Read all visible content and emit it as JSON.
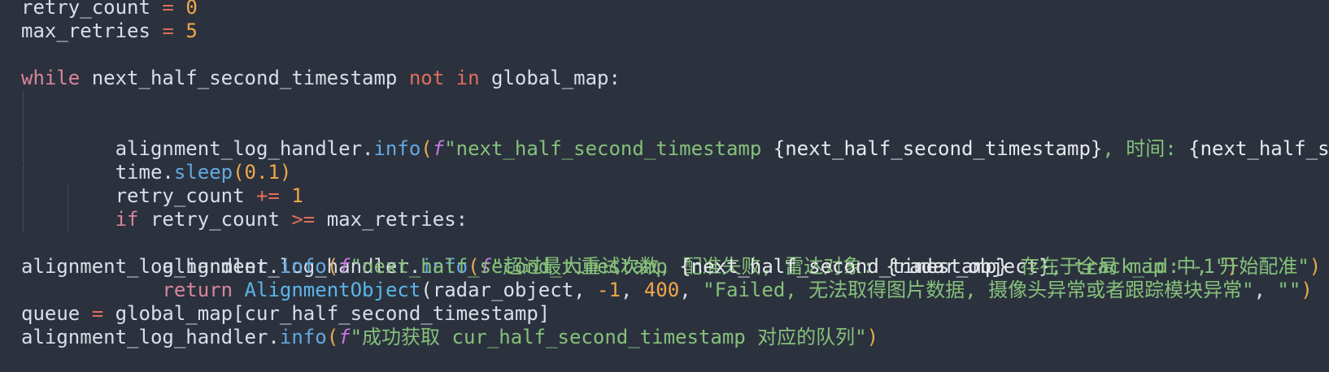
{
  "editor": {
    "lines": [
      [
        {
          "t": "retry_count",
          "c": "var"
        },
        {
          "t": " ",
          "c": "var"
        },
        {
          "t": "=",
          "c": "op"
        },
        {
          "t": " ",
          "c": "var"
        },
        {
          "t": "0",
          "c": "num"
        }
      ],
      [
        {
          "t": "max_retries",
          "c": "var"
        },
        {
          "t": " ",
          "c": "var"
        },
        {
          "t": "=",
          "c": "op"
        },
        {
          "t": " ",
          "c": "var"
        },
        {
          "t": "5",
          "c": "num"
        }
      ],
      [],
      [
        {
          "t": "while",
          "c": "kw"
        },
        {
          "t": " next_half_second_timestamp ",
          "c": "var"
        },
        {
          "t": "not",
          "c": "op"
        },
        {
          "t": " ",
          "c": "var"
        },
        {
          "t": "in",
          "c": "op"
        },
        {
          "t": " global_map:",
          "c": "var"
        }
      ],
      [
        {
          "t": "    ",
          "c": "var"
        },
        {
          "t": "alignment_log_handler.",
          "c": "var"
        },
        {
          "t": "info",
          "c": "fn"
        },
        {
          "t": "(",
          "c": "paren"
        },
        {
          "t": "f",
          "c": "fpre"
        },
        {
          "t": "\"next_half_second_timestamp ",
          "c": "str"
        },
        {
          "t": "{next_half_second_timestamp}",
          "c": "brace"
        },
        {
          "t": ", 时间: ",
          "c": "str"
        },
        {
          "t": "{next_half_second_timestamp_str}\")",
          "c": "brace"
        }
      ],
      [
        {
          "t": "    ",
          "c": "var"
        },
        {
          "t": "time.",
          "c": "var"
        },
        {
          "t": "sleep",
          "c": "fn"
        },
        {
          "t": "(",
          "c": "paren"
        },
        {
          "t": "0.1",
          "c": "num"
        },
        {
          "t": ")",
          "c": "paren"
        }
      ],
      [
        {
          "t": "    ",
          "c": "var"
        },
        {
          "t": "retry_count ",
          "c": "var"
        },
        {
          "t": "+=",
          "c": "op"
        },
        {
          "t": " ",
          "c": "var"
        },
        {
          "t": "1",
          "c": "num"
        }
      ],
      [
        {
          "t": "    ",
          "c": "var"
        },
        {
          "t": "if",
          "c": "kw"
        },
        {
          "t": " retry_count ",
          "c": "var"
        },
        {
          "t": ">=",
          "c": "op"
        },
        {
          "t": " max_retries:",
          "c": "var"
        }
      ],
      [
        {
          "t": "        ",
          "c": "var"
        },
        {
          "t": "alignment_log_handler.",
          "c": "var"
        },
        {
          "t": "info",
          "c": "fn"
        },
        {
          "t": "(",
          "c": "paren"
        },
        {
          "t": "f",
          "c": "fpre"
        },
        {
          "t": "\"超过最大重试次数, 配准失败, 雷达对象: ",
          "c": "str"
        },
        {
          "t": "{radar_object}",
          "c": "brace"
        },
        {
          "t": ", track_id: -1\"",
          "c": "str"
        },
        {
          "t": ")",
          "c": "paren"
        }
      ],
      [
        {
          "t": "        ",
          "c": "var"
        },
        {
          "t": "return",
          "c": "kw"
        },
        {
          "t": " ",
          "c": "var"
        },
        {
          "t": "AlignmentObject",
          "c": "cls"
        },
        {
          "t": "(radar_object, ",
          "c": "var"
        },
        {
          "t": "-1",
          "c": "num"
        },
        {
          "t": ", ",
          "c": "var"
        },
        {
          "t": "400",
          "c": "num"
        },
        {
          "t": ", ",
          "c": "var"
        },
        {
          "t": "\"Failed, 无法取得图片数据, 摄像头异常或者跟踪模块异常\"",
          "c": "str"
        },
        {
          "t": ", ",
          "c": "var"
        },
        {
          "t": "\"\"",
          "c": "str"
        },
        {
          "t": ")",
          "c": "paren"
        }
      ],
      [],
      [
        {
          "t": "alignment_log_handler.",
          "c": "var"
        },
        {
          "t": "info",
          "c": "fn"
        },
        {
          "t": "(",
          "c": "paren"
        },
        {
          "t": "f",
          "c": "fpre"
        },
        {
          "t": "\"next_half_second_timestamp ",
          "c": "str"
        },
        {
          "t": "{next_half_second_timestamp}",
          "c": "brace"
        },
        {
          "t": " 存在于全局 map 中, 开始配准\"",
          "c": "str"
        },
        {
          "t": ")",
          "c": "paren"
        }
      ],
      [],
      [
        {
          "t": "queue ",
          "c": "var"
        },
        {
          "t": "=",
          "c": "op"
        },
        {
          "t": " global_map[cur_half_second_timestamp]",
          "c": "var"
        }
      ],
      [
        {
          "t": "alignment_log_handler.",
          "c": "var"
        },
        {
          "t": "info",
          "c": "fn"
        },
        {
          "t": "(",
          "c": "paren"
        },
        {
          "t": "f",
          "c": "fpre"
        },
        {
          "t": "\"成功获取 cur_half_second_timestamp 对应的队列\"",
          "c": "str"
        },
        {
          "t": ")",
          "c": "paren"
        }
      ]
    ]
  }
}
